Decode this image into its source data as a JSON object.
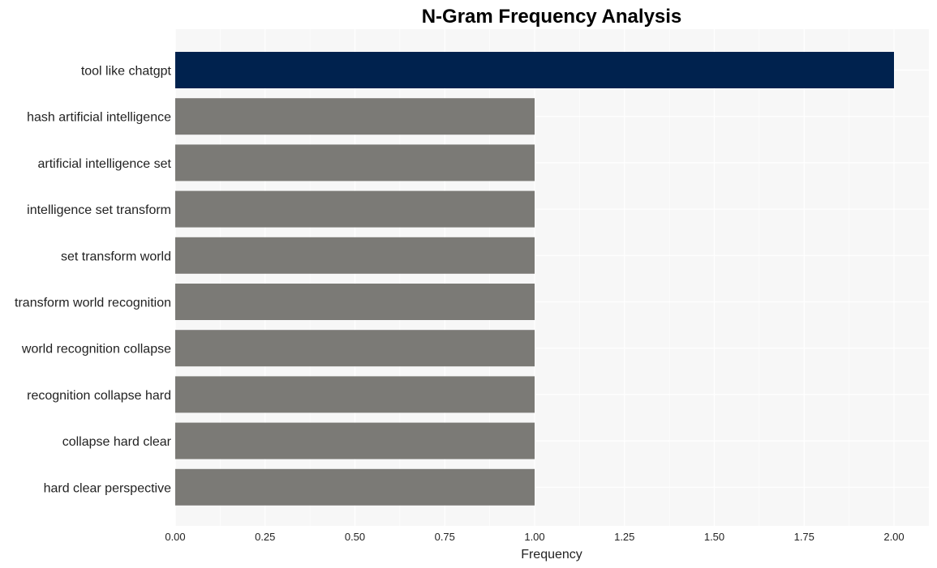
{
  "chart_data": {
    "type": "bar",
    "orientation": "horizontal",
    "title": "N-Gram Frequency Analysis",
    "xlabel": "Frequency",
    "ylabel": "",
    "xlim": [
      0,
      2.1
    ],
    "xticks": [
      0.0,
      0.25,
      0.5,
      0.75,
      1.0,
      1.25,
      1.5,
      1.75,
      2.0
    ],
    "xtick_labels": [
      "0.00",
      "0.25",
      "0.50",
      "0.75",
      "1.00",
      "1.25",
      "1.50",
      "1.75",
      "2.00"
    ],
    "grid": true,
    "legend": "none",
    "categories": [
      "tool like chatgpt",
      "hash artificial intelligence",
      "artificial intelligence set",
      "intelligence set transform",
      "set transform world",
      "transform world recognition",
      "world recognition collapse",
      "recognition collapse hard",
      "collapse hard clear",
      "hard clear perspective"
    ],
    "values": [
      2,
      1,
      1,
      1,
      1,
      1,
      1,
      1,
      1,
      1
    ],
    "colors": {
      "highlight": "#00224e",
      "default": "#7b7a76",
      "panel_background": "#f7f7f7",
      "grid": "#ffffff"
    }
  }
}
